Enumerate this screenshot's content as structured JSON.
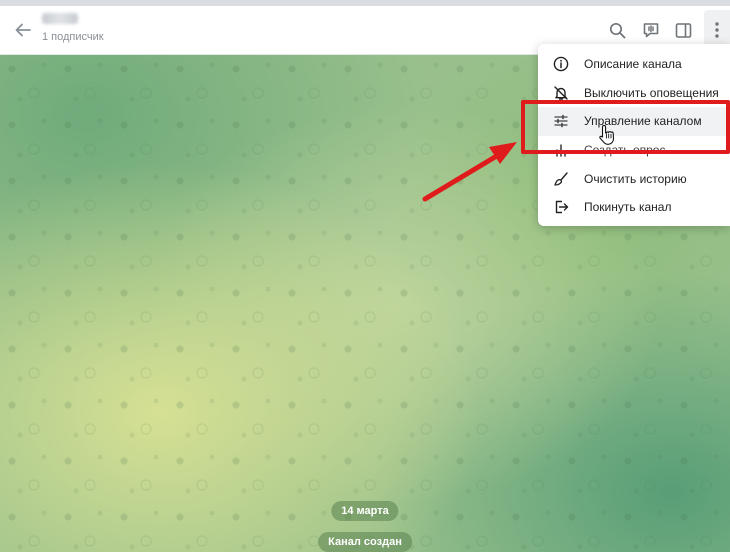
{
  "header": {
    "subtitle": "1 подписчик",
    "icons": [
      "back-arrow-icon",
      "search-icon",
      "live-stream-icon",
      "sidebar-toggle-icon",
      "more-vertical-icon"
    ]
  },
  "chat": {
    "date_label": "14 марта",
    "service_message": "Канал создан"
  },
  "menu": {
    "items": [
      {
        "label": "Описание канала",
        "icon": "info-icon"
      },
      {
        "label": "Выключить оповещения",
        "icon": "mute-icon"
      },
      {
        "label": "Управление каналом",
        "icon": "sliders-icon"
      },
      {
        "label": "Создать опрос",
        "icon": "poll-icon"
      },
      {
        "label": "Очистить историю",
        "icon": "broom-icon"
      },
      {
        "label": "Покинуть канал",
        "icon": "leave-icon"
      }
    ]
  },
  "annotation": {
    "color": "#e01b1b"
  }
}
